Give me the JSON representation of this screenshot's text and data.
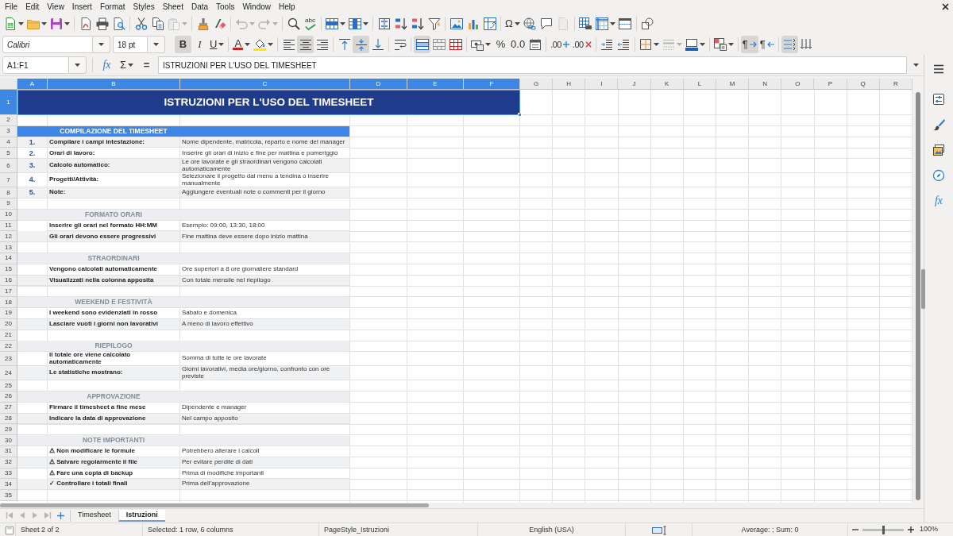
{
  "menu": [
    "File",
    "Edit",
    "View",
    "Insert",
    "Format",
    "Styles",
    "Sheet",
    "Data",
    "Tools",
    "Window",
    "Help"
  ],
  "standard_toolbar": [
    [
      {
        "kind": "split",
        "disabled": false
      },
      {
        "kind": "split",
        "disabled": false
      },
      {
        "kind": "split",
        "disabled": false
      }
    ],
    [
      {
        "kind": "button",
        "disabled": false
      },
      {
        "kind": "button",
        "disabled": false
      },
      {
        "kind": "button",
        "disabled": false
      }
    ],
    [
      {
        "kind": "button",
        "disabled": false
      },
      {
        "kind": "button",
        "disabled": false
      },
      {
        "kind": "split",
        "disabled": true
      }
    ],
    [
      {
        "kind": "button",
        "disabled": false
      },
      {
        "kind": "button",
        "disabled": false
      }
    ],
    [
      {
        "kind": "split",
        "disabled": true
      },
      {
        "kind": "split",
        "disabled": true
      }
    ],
    [
      {
        "kind": "button",
        "disabled": false
      },
      {
        "kind": "button",
        "disabled": false,
        "label": "abc"
      }
    ],
    [
      {
        "kind": "split",
        "disabled": false
      },
      {
        "kind": "split",
        "disabled": false
      }
    ],
    [
      {
        "kind": "button",
        "disabled": false
      },
      {
        "kind": "button",
        "disabled": false
      },
      {
        "kind": "button",
        "disabled": false
      },
      {
        "kind": "button",
        "disabled": false
      }
    ],
    [
      {
        "kind": "button",
        "disabled": false
      },
      {
        "kind": "button",
        "disabled": false
      },
      {
        "kind": "button",
        "disabled": false
      }
    ],
    [
      {
        "kind": "split",
        "disabled": false,
        "label": "Ω"
      },
      {
        "kind": "button",
        "disabled": false
      },
      {
        "kind": "button",
        "disabled": false
      },
      {
        "kind": "button",
        "disabled": true
      }
    ],
    [
      {
        "kind": "button",
        "disabled": false
      },
      {
        "kind": "split",
        "disabled": false
      },
      {
        "kind": "button",
        "disabled": false
      }
    ],
    [
      {
        "kind": "button",
        "disabled": false
      }
    ]
  ],
  "formatting_toolbar": {
    "font_name": "Calibri",
    "font_size": "18 pt",
    "groups": [
      [
        {
          "kind": "button",
          "pressed": true,
          "disabled": false,
          "label": "B"
        },
        {
          "kind": "button",
          "pressed": false,
          "disabled": false,
          "label": "I"
        },
        {
          "kind": "split",
          "pressed": false,
          "disabled": false,
          "label": "U"
        }
      ],
      [
        {
          "kind": "split",
          "pressed": false,
          "disabled": false,
          "label": "A"
        },
        {
          "kind": "split",
          "pressed": false,
          "disabled": false
        }
      ],
      [
        {
          "kind": "button",
          "pressed": false,
          "disabled": false
        },
        {
          "kind": "button",
          "pressed": true,
          "disabled": false
        },
        {
          "kind": "button",
          "pressed": false,
          "disabled": false
        }
      ],
      [
        {
          "kind": "button",
          "pressed": false,
          "disabled": false
        },
        {
          "kind": "button",
          "pressed": true,
          "disabled": false
        },
        {
          "kind": "button",
          "pressed": false,
          "disabled": false
        }
      ],
      [
        {
          "kind": "button",
          "pressed": false,
          "disabled": false
        }
      ],
      [
        {
          "kind": "button",
          "pressed": true,
          "disabled": false
        },
        {
          "kind": "button",
          "pressed": false,
          "disabled": false
        },
        {
          "kind": "button",
          "pressed": false,
          "disabled": false
        }
      ],
      [
        {
          "kind": "split",
          "pressed": false,
          "disabled": false
        },
        {
          "kind": "button",
          "pressed": false,
          "disabled": false,
          "label": "%"
        },
        {
          "kind": "button",
          "pressed": false,
          "disabled": false,
          "label": "0.0"
        },
        {
          "kind": "button",
          "pressed": false,
          "disabled": false
        }
      ],
      [
        {
          "kind": "button",
          "pressed": false,
          "disabled": false,
          "label": ".00"
        },
        {
          "kind": "button",
          "pressed": false,
          "disabled": false,
          "label": ".00"
        }
      ],
      [
        {
          "kind": "button",
          "pressed": false,
          "disabled": false
        },
        {
          "kind": "button",
          "pressed": false,
          "disabled": false
        }
      ],
      [
        {
          "kind": "split",
          "pressed": false,
          "disabled": false
        },
        {
          "kind": "split",
          "pressed": false,
          "disabled": true
        },
        {
          "kind": "split",
          "pressed": false,
          "disabled": false
        }
      ],
      [
        {
          "kind": "split",
          "pressed": false,
          "disabled": false
        }
      ],
      [
        {
          "kind": "button",
          "pressed": true,
          "disabled": false,
          "label": "¶"
        },
        {
          "kind": "button",
          "pressed": false,
          "disabled": false,
          "label": "¶"
        }
      ],
      [
        {
          "kind": "button",
          "pressed": true,
          "disabled": false
        },
        {
          "kind": "button",
          "pressed": false,
          "disabled": false
        }
      ]
    ]
  },
  "formula_bar": {
    "name_box": "A1:F1",
    "function_wizard": "fx",
    "sum": "Σ",
    "formula": "=",
    "content": "ISTRUZIONI PER L'USO DEL TIMESHEET"
  },
  "columns": [
    {
      "label": "A",
      "selected": true
    },
    {
      "label": "B",
      "selected": true
    },
    {
      "label": "C",
      "selected": true
    },
    {
      "label": "D",
      "selected": true
    },
    {
      "label": "E",
      "selected": true
    },
    {
      "label": "F",
      "selected": true
    },
    {
      "label": "G",
      "selected": false
    },
    {
      "label": "H",
      "selected": false
    },
    {
      "label": "I",
      "selected": false
    },
    {
      "label": "J",
      "selected": false
    },
    {
      "label": "K",
      "selected": false
    },
    {
      "label": "L",
      "selected": false
    },
    {
      "label": "M",
      "selected": false
    },
    {
      "label": "N",
      "selected": false
    },
    {
      "label": "O",
      "selected": false
    },
    {
      "label": "P",
      "selected": false
    },
    {
      "label": "Q",
      "selected": false
    },
    {
      "label": "R",
      "selected": false
    }
  ],
  "rows": [
    {
      "number": "1",
      "selected": true,
      "kind": "title",
      "text": "ISTRUZIONI PER L'USO DEL TIMESHEET"
    },
    {
      "number": "2",
      "selected": false,
      "kind": "blank"
    },
    {
      "number": "3",
      "selected": false,
      "kind": "section",
      "text": "COMPILAZIONE DEL TIMESHEET",
      "color": "#3d85e6"
    },
    {
      "number": "4",
      "selected": false,
      "kind": "step",
      "step": "1.",
      "label": "Compilare i campi intestazione:",
      "detail": "Nome dipendente, matricola, reparto e nome del manager",
      "shaded": true
    },
    {
      "number": "5",
      "selected": false,
      "kind": "step",
      "step": "2.",
      "label": "Orari di lavoro:",
      "detail": "Inserire gli orari di inizio e fine per mattina e pomeriggio",
      "shaded": false
    },
    {
      "number": "6",
      "selected": false,
      "kind": "step",
      "step": "3.",
      "label": "Calcolo automatico:",
      "detail": "Le ore lavorate e gli straordinari vengono calcolati automaticamente",
      "shaded": true
    },
    {
      "number": "7",
      "selected": false,
      "kind": "step",
      "step": "4.",
      "label": "Progetti/Attività:",
      "detail": "Selezionare il progetto dal menu a tendina o inserire manualmente",
      "shaded": false
    },
    {
      "number": "8",
      "selected": false,
      "kind": "step",
      "step": "5.",
      "label": "Note:",
      "detail": "Aggiungere eventuali note o commenti per il giorno",
      "shaded": true
    },
    {
      "number": "9",
      "selected": false,
      "kind": "blank"
    },
    {
      "number": "10",
      "selected": false,
      "kind": "section",
      "text": "FORMATO ORARI",
      "color": "#eceef1"
    },
    {
      "number": "11",
      "selected": false,
      "kind": "entry",
      "label": "Inserire gli orari nel formato HH:MM",
      "detail": "Esempio: 09:00, 13:30, 18:00",
      "shaded": false
    },
    {
      "number": "12",
      "selected": false,
      "kind": "entry",
      "label": "Gli orari devono essere progressivi",
      "detail": "Fine mattina deve essere dopo inizio mattina",
      "shaded": true
    },
    {
      "number": "13",
      "selected": false,
      "kind": "blank"
    },
    {
      "number": "14",
      "selected": false,
      "kind": "section",
      "text": "STRAORDINARI",
      "color": "#eceef1"
    },
    {
      "number": "15",
      "selected": false,
      "kind": "entry",
      "label": "Vengono calcolati automaticamente",
      "detail": "Ore superiori a 8 ore giornaliere standard",
      "shaded": false
    },
    {
      "number": "16",
      "selected": false,
      "kind": "entry",
      "label": "Visualizzati nella colonna apposita",
      "detail": "Con totale mensile nel riepilogo",
      "shaded": true
    },
    {
      "number": "17",
      "selected": false,
      "kind": "blank"
    },
    {
      "number": "18",
      "selected": false,
      "kind": "section",
      "text": "WEEKEND E FESTIVITÀ",
      "color": "#eceef1"
    },
    {
      "number": "19",
      "selected": false,
      "kind": "entry",
      "label": "I weekend sono evidenziati in rosso",
      "detail": "Sabato e domenica",
      "shaded": false
    },
    {
      "number": "20",
      "selected": false,
      "kind": "entry",
      "label": "Lasciare vuoti i giorni non lavorativi",
      "detail": "A meno di lavoro effettivo",
      "shaded": true
    },
    {
      "number": "21",
      "selected": false,
      "kind": "blank"
    },
    {
      "number": "22",
      "selected": false,
      "kind": "section",
      "text": "RIEPILOGO",
      "color": "#eceef1"
    },
    {
      "number": "23",
      "selected": false,
      "kind": "entry",
      "label": "Il totale ore viene calcolato automaticamente",
      "detail": "Somma di tutte le ore lavorate",
      "shaded": false
    },
    {
      "number": "24",
      "selected": false,
      "kind": "entry",
      "label": "Le statistiche mostrano:",
      "detail": "Giorni lavorativi, media ore/giorno, confronto con ore previste",
      "shaded": true
    },
    {
      "number": "25",
      "selected": false,
      "kind": "blank"
    },
    {
      "number": "26",
      "selected": false,
      "kind": "section",
      "text": "APPROVAZIONE",
      "color": "#eceef1"
    },
    {
      "number": "27",
      "selected": false,
      "kind": "entry",
      "label": "Firmare il timesheet a fine mese",
      "detail": "Dipendente e manager",
      "shaded": false
    },
    {
      "number": "28",
      "selected": false,
      "kind": "entry",
      "label": "Indicare la data di approvazione",
      "detail": "Nel campo apposito",
      "shaded": true
    },
    {
      "number": "29",
      "selected": false,
      "kind": "blank"
    },
    {
      "number": "30",
      "selected": false,
      "kind": "section",
      "text": "NOTE IMPORTANTI",
      "color": "#eceef1"
    },
    {
      "number": "31",
      "selected": false,
      "kind": "entry",
      "label": "⚠ Non modificare le formule",
      "detail": "Potrebbero alterare i calcoli",
      "shaded": false
    },
    {
      "number": "32",
      "selected": false,
      "kind": "entry",
      "label": "⚠ Salvare regolarmente il file",
      "detail": "Per evitare perdite di dati",
      "shaded": true
    },
    {
      "number": "33",
      "selected": false,
      "kind": "entry",
      "label": "⚠ Fare una copia di backup",
      "detail": "Prima di modifiche importanti",
      "shaded": false
    },
    {
      "number": "34",
      "selected": false,
      "kind": "entry",
      "label": "✓ Controllare i totali finali",
      "detail": "Prima dell’approvazione",
      "shaded": true
    },
    {
      "number": "35",
      "selected": false,
      "kind": "blank"
    }
  ],
  "sheet_tabs": {
    "navigation_disabled": true,
    "tabs": [
      {
        "label": "Timesheet",
        "selected": false
      },
      {
        "label": "Istruzioni",
        "selected": true
      }
    ]
  },
  "sidebar": {
    "functions_tab": "fx"
  },
  "status_bar": {
    "sheet": "Sheet 2 of 2",
    "selection": "Selected: 1 row, 6 columns",
    "page_style": "PageStyle_Istruzioni",
    "language": "English (USA)",
    "summary": "Average: ; Sum: 0",
    "zoom_slider": {
      "level": 0.5
    },
    "zoom": "100%"
  }
}
